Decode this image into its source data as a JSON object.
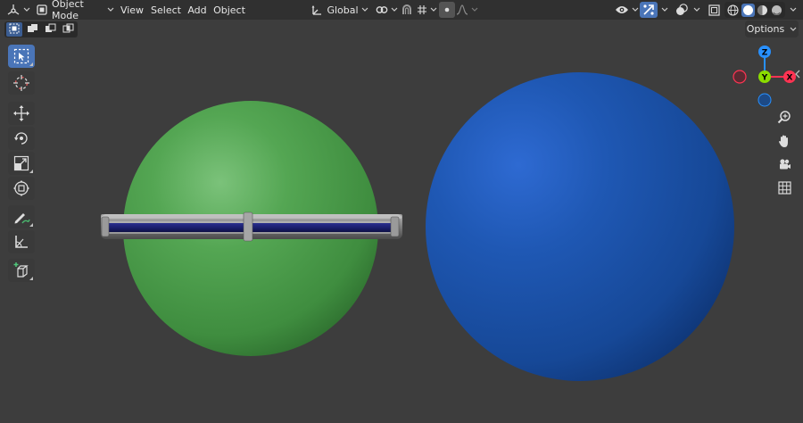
{
  "header": {
    "mode_label": "Object Mode",
    "menus": [
      "View",
      "Select",
      "Add",
      "Object"
    ],
    "transform_orientation": "Global"
  },
  "subheader": {
    "options_label": "Options"
  },
  "toolbar": {
    "tools": [
      "select-box",
      "cursor",
      "move",
      "rotate",
      "scale",
      "transform",
      "annotate",
      "measure",
      "add-cube"
    ],
    "active_tool": "select-box"
  },
  "gizmo": {
    "axes": {
      "x": {
        "label": "X",
        "color": "#ff3352"
      },
      "y": {
        "label": "Y",
        "color": "#8bdc00"
      },
      "z": {
        "label": "Z",
        "color": "#2890ff"
      }
    }
  },
  "scene_objects": [
    {
      "name": "green-sphere",
      "color": "#4ea04d"
    },
    {
      "name": "blue-sphere",
      "color": "#1f57b0"
    },
    {
      "name": "ring-band",
      "color": "#8a8a8a",
      "inner_color": "#1c1f7a"
    }
  ],
  "colors": {
    "header_bg": "#303030",
    "viewport_bg": "#3d3d3d",
    "active_blue": "#4a75b8"
  }
}
